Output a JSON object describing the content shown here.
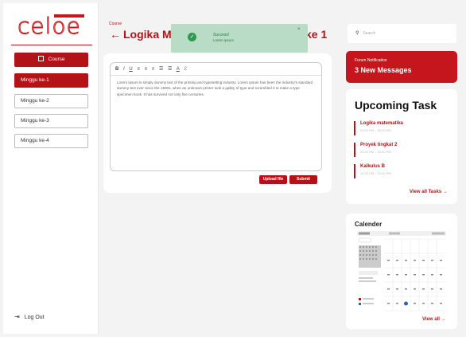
{
  "sidebar": {
    "logo_text": "celoe",
    "course_label": "Course",
    "items": [
      {
        "label": "Minggu ke-1",
        "active": true
      },
      {
        "label": "Minggu ke-2",
        "active": false
      },
      {
        "label": "Minggu ke-3",
        "active": false
      },
      {
        "label": "Minggu ke-4",
        "active": false
      }
    ],
    "logout_label": "Log Out"
  },
  "main": {
    "breadcrumb": "Course",
    "title": "Logika Ma",
    "title_tail": "ke 1",
    "editor": {
      "toolbar": [
        "B",
        "I",
        "U",
        "≡",
        "≡",
        "≡",
        "☰",
        "☰",
        "A",
        "ℰ"
      ],
      "text": "Lorem Ipsum is simply dummy text of the printing and typesetting industry. Lorem Ipsum has been the industry's standard dummy text ever since the 1500s, when an unknown printer took a galley of type and scrambled it to make a type specimen book. It has survived not only five centuries."
    },
    "upload_label": "Upload file",
    "submit_label": "Submit"
  },
  "toast": {
    "title": "Success!",
    "message": "Lorem ipsum",
    "close": "×"
  },
  "search": {
    "placeholder": "Search"
  },
  "notification": {
    "label": "Forum Notification",
    "message": "3 New Messages"
  },
  "tasks": {
    "heading": "Upcoming Task",
    "items": [
      {
        "name": "Logika matematika",
        "time": "03.00 PM – 05.00 PM"
      },
      {
        "name": "Proyek tingkat 2",
        "time": "02.00 PM – 04.00 PM"
      },
      {
        "name": "Kalkulus B",
        "time": "12.00 PM – 04.30 PM"
      }
    ],
    "view_all": "View all Tasks →"
  },
  "calendar": {
    "heading": "Calender",
    "view_all": "View all →"
  },
  "colors": {
    "brand": "#b31217",
    "success_bg": "#b9dcc6"
  }
}
